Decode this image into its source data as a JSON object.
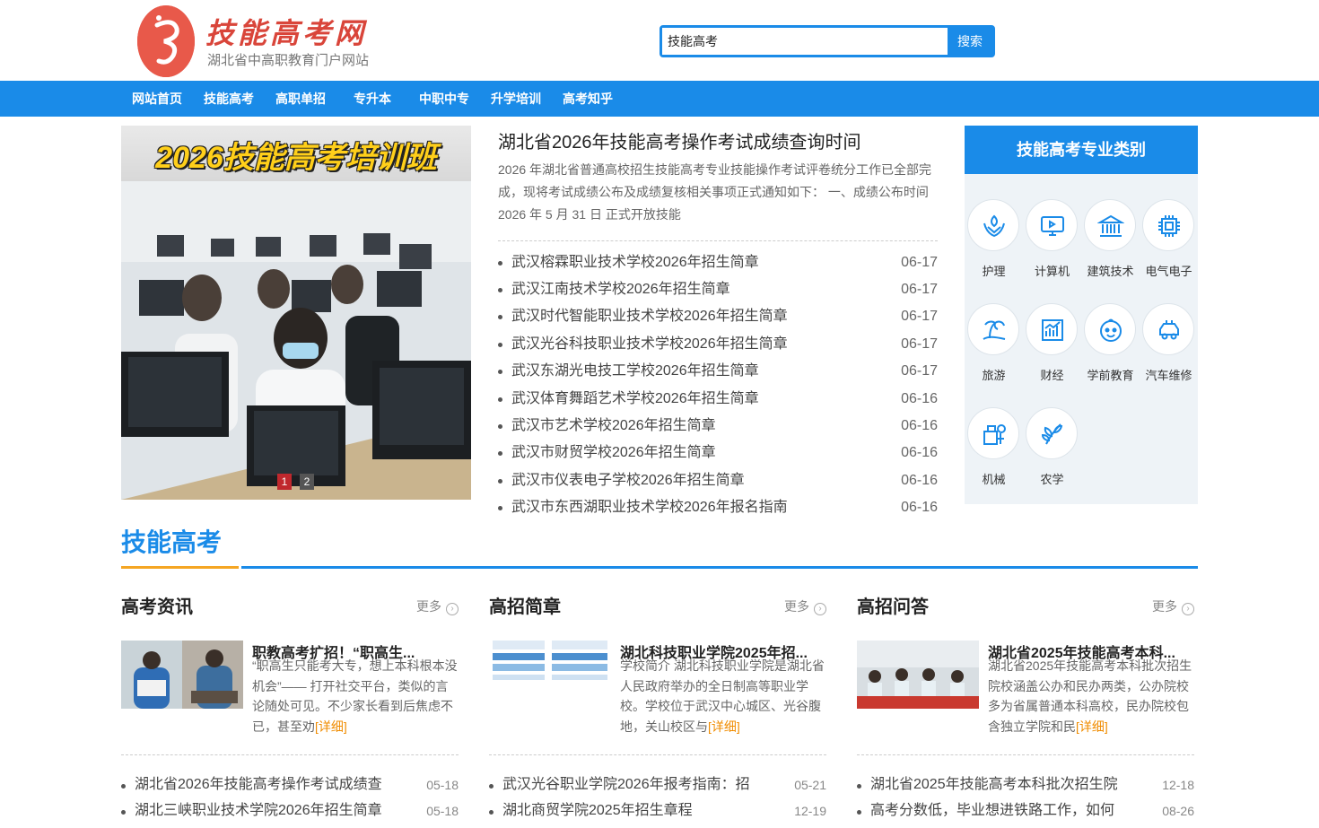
{
  "header": {
    "logo_title": "技能高考网",
    "logo_subtitle": "湖北省中高职教育门户网站",
    "search_value": "技能高考",
    "search_button": "搜索"
  },
  "nav": {
    "items": [
      "网站首页",
      "技能高考",
      "高职单招",
      "专升本",
      "中职中专",
      "升学培训",
      "高考知乎"
    ]
  },
  "slider": {
    "banner_text": "2026技能高考培训班",
    "pages": [
      "1",
      "2"
    ],
    "active_page": 1,
    "colors": {
      "active": "#c0282d",
      "inactive": "#555555"
    }
  },
  "featured": {
    "title": "湖北省2026年技能高考操作考试成绩查询时间",
    "summary": "2026 年湖北省普通高校招生技能高考专业技能操作考试评卷统分工作已全部完成，现将考试成绩公布及成绩复核相关事项正式通知如下： 一、成绩公布时间 2026 年 5 月 31 日 正式开放技能"
  },
  "news": [
    {
      "title": "武汉榕霖职业技术学校2026年招生简章",
      "date": "06-17"
    },
    {
      "title": "武汉江南技术学校2026年招生简章",
      "date": "06-17"
    },
    {
      "title": "武汉时代智能职业技术学校2026年招生简章",
      "date": "06-17"
    },
    {
      "title": "武汉光谷科技职业技术学校2026年招生简章",
      "date": "06-17"
    },
    {
      "title": "武汉东湖光电技工学校2026年招生简章",
      "date": "06-17"
    },
    {
      "title": "武汉体育舞蹈艺术学校2026年招生简章",
      "date": "06-16"
    },
    {
      "title": "武汉市艺术学校2026年招生简章",
      "date": "06-16"
    },
    {
      "title": "武汉市财贸学校2026年招生简章",
      "date": "06-16"
    },
    {
      "title": "武汉市仪表电子学校2026年招生简章",
      "date": "06-16"
    },
    {
      "title": "武汉市东西湖职业技术学校2026年报名指南",
      "date": "06-16"
    }
  ],
  "categories": {
    "title": "技能高考专业类别",
    "items": [
      {
        "label": "护理",
        "icon": "nursing-icon"
      },
      {
        "label": "计算机",
        "icon": "computer-icon"
      },
      {
        "label": "建筑技术",
        "icon": "building-icon"
      },
      {
        "label": "电气电子",
        "icon": "chip-icon"
      },
      {
        "label": "旅游",
        "icon": "beach-icon"
      },
      {
        "label": "财经",
        "icon": "finance-chart-icon"
      },
      {
        "label": "学前教育",
        "icon": "baby-face-icon"
      },
      {
        "label": "汽车维修",
        "icon": "car-repair-icon"
      },
      {
        "label": "机械",
        "icon": "machinery-icon"
      },
      {
        "label": "农学",
        "icon": "plant-icon"
      }
    ]
  },
  "section": {
    "title": "技能高考",
    "colors": {
      "primary": "#1a8be8",
      "accent": "#f5a623"
    }
  },
  "columns": [
    {
      "title": "高考资讯",
      "more": "更多",
      "article_title": "职教高考扩招！“职高生...",
      "article_desc": "“职高生只能考大专，想上本科根本没机会”—— 打开社交平台，类似的言论随处可见。不少家长看到后焦虑不已，甚至劝",
      "detail": "[详细]",
      "list": [
        {
          "title": "湖北省2026年技能高考操作考试成绩查",
          "date": "05-18"
        },
        {
          "title": "湖北三峡职业技术学院2026年招生简章",
          "date": "05-18"
        }
      ]
    },
    {
      "title": "高招简章",
      "more": "更多",
      "article_title": "湖北科技职业学院2025年招...",
      "article_desc": "学校简介 湖北科技职业学院是湖北省人民政府举办的全日制高等职业学校。学校位于武汉中心城区、光谷腹地，关山校区与",
      "detail": "[详细]",
      "list": [
        {
          "title": "武汉光谷职业学院2026年报考指南：招",
          "date": "05-21"
        },
        {
          "title": "湖北商贸学院2025年招生章程",
          "date": "12-19"
        }
      ]
    },
    {
      "title": "高招问答",
      "more": "更多",
      "article_title": "湖北省2025年技能高考本科...",
      "article_desc": "湖北省2025年技能高考本科批次招生院校涵盖公办和民办两类，公办院校多为省属普通本科高校，民办院校包含独立学院和民",
      "detail": "[详细]",
      "list": [
        {
          "title": "湖北省2025年技能高考本科批次招生院",
          "date": "12-18"
        },
        {
          "title": "高考分数低，毕业想进铁路工作，如何",
          "date": "08-26"
        }
      ]
    }
  ]
}
